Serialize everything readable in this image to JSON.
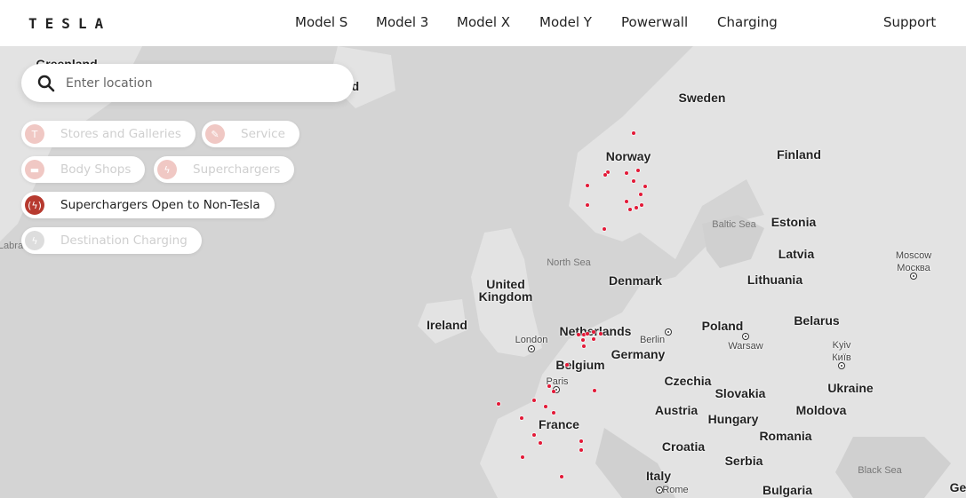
{
  "header": {
    "logo": "TESLA",
    "nav": [
      "Model S",
      "Model 3",
      "Model X",
      "Model Y",
      "Powerwall",
      "Charging"
    ],
    "support": "Support"
  },
  "search": {
    "placeholder": "Enter location",
    "value": ""
  },
  "filters": [
    {
      "label": "Stores and Galleries",
      "icon": "tesla-t-icon",
      "active": false
    },
    {
      "label": "Service",
      "icon": "wrench-icon",
      "active": false
    },
    {
      "label": "Body Shops",
      "icon": "car-icon",
      "active": false
    },
    {
      "label": "Superchargers",
      "icon": "bolt-icon",
      "active": false
    },
    {
      "label": "Superchargers Open to Non-Tesla",
      "icon": "bolt-signal-icon",
      "active": true
    },
    {
      "label": "Destination Charging",
      "icon": "bolt-icon",
      "active": false
    }
  ],
  "colors": {
    "accent": "#b73a2f",
    "marker": "#e31937",
    "sea": "#d4d4d4",
    "land": "#e3e3e3"
  },
  "map": {
    "labels": [
      "Greenland",
      "Iceland",
      "Sweden",
      "Norway",
      "Finland",
      "Estonia",
      "Baltic Sea",
      "Latvia",
      "North Sea",
      "United\nKingdom",
      "Denmark",
      "Lithuania",
      "Moscow\nМосква",
      "Ireland",
      "Poland",
      "Belarus",
      "Netherlands",
      "London",
      "Berlin",
      "Warsaw",
      "Kyiv\nКиїв",
      "Germany",
      "Belgium",
      "Paris",
      "Czechia",
      "Slovakia",
      "Ukraine",
      "Austria",
      "Moldova",
      "Hungary",
      "France",
      "Romania",
      "Croatia",
      "Serbia",
      "Black Sea",
      "Italy",
      "Rome",
      "Bulgaria",
      "Ge",
      "Labra"
    ]
  }
}
